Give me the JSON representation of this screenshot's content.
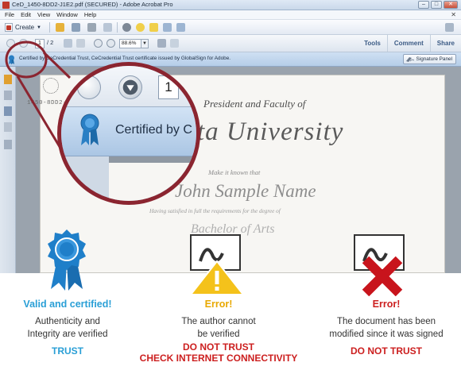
{
  "window": {
    "title": "CeD_1450-8DD2-J1E2.pdf (SECURED) - Adobe Acrobat Pro",
    "minimize": "–",
    "maximize": "□",
    "close": "✕"
  },
  "menu": {
    "items": [
      "File",
      "Edit",
      "View",
      "Window",
      "Help"
    ],
    "close": "✕"
  },
  "toolbar": {
    "create_label": "Create",
    "page_current": "1",
    "page_total": "/ 2",
    "zoom_value": "88.6%",
    "tabs": [
      "Tools",
      "Comment",
      "Share"
    ]
  },
  "cert_bar": {
    "message": "Certified by CeCredential Trust, CeCredential Trust certificate issued by GlobalSign for Adobe.",
    "signature_panel_label": "Signature Panel"
  },
  "document": {
    "serial": "1450-8DD2-J",
    "line_president": "President and Faculty of",
    "line_university": "ta University",
    "line_known": "Make it known that",
    "line_name": "John Sample Name",
    "line_having": "Having satisfied in full the requirements for the degree of",
    "line_degree": "Bachelor of Arts"
  },
  "magnifier": {
    "page_number": "1",
    "certified_text": "Certified by C"
  },
  "legend": [
    {
      "title": "Valid and certified!",
      "description_lines": [
        "Authenticity and",
        "Integrity are verified"
      ],
      "verdict_lines": [
        "TRUST"
      ],
      "title_color": "#2a9fd6",
      "verdict_color": "#2a9fd6",
      "icon": "blue-ribbon-icon"
    },
    {
      "title": "Error!",
      "description_lines": [
        "The author cannot",
        "be verified"
      ],
      "verdict_lines": [
        "DO NOT TRUST",
        "CHECK INTERNET CONNECTIVITY"
      ],
      "title_color": "#e8a800",
      "verdict_color": "#cc1f1f",
      "icon": "warning-signature-icon"
    },
    {
      "title": "Error!",
      "description_lines": [
        "The document has been",
        "modified since it was signed"
      ],
      "verdict_lines": [
        "DO NOT TRUST"
      ],
      "title_color": "#cc1f1f",
      "verdict_color": "#cc1f1f",
      "icon": "invalid-signature-icon"
    }
  ],
  "colors": {
    "magnifier_ring": "#8b2530",
    "ribbon_blue": "#1f7fc9",
    "warning_yellow": "#f4c21b",
    "error_red": "#c8141c"
  }
}
